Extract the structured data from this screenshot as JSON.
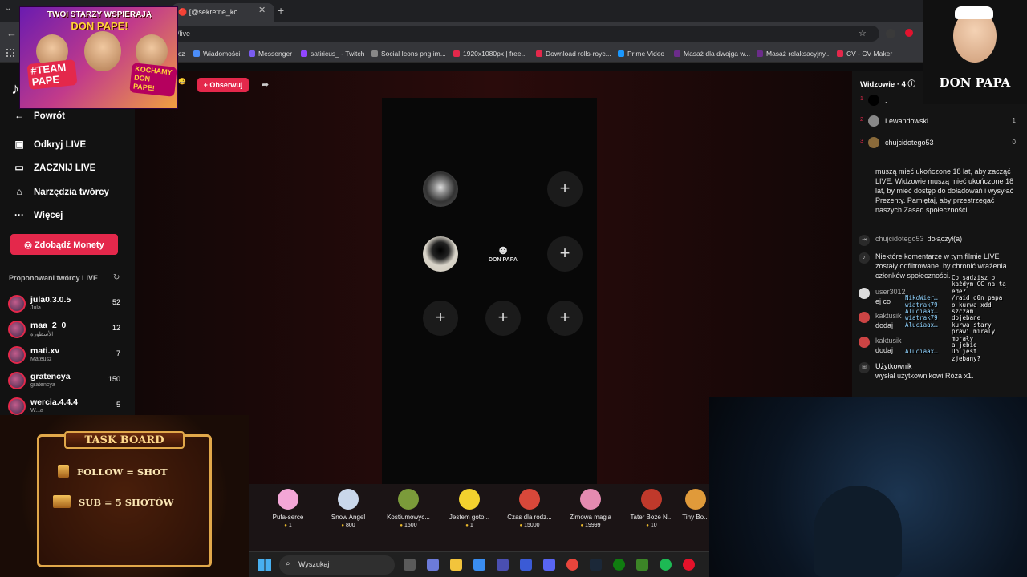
{
  "browser": {
    "tab_title": "🔴 [@sekretne_ko",
    "url": "7/live",
    "bookmarks": [
      {
        "label": "cz",
        "color": "#555"
      },
      {
        "label": "Wiadomości",
        "color": "#4b8df8"
      },
      {
        "label": "Messenger",
        "color": "#7a5cf0"
      },
      {
        "label": "satiricus_ - Twitch",
        "color": "#9146ff"
      },
      {
        "label": "Social Icons png im...",
        "color": "#888"
      },
      {
        "label": "1920x1080px | free...",
        "color": "#e4284b"
      },
      {
        "label": "Download rolls-royc...",
        "color": "#e4284b"
      },
      {
        "label": "Prime Video",
        "color": "#1a98ff"
      },
      {
        "label": "Masaż dla dwojga w...",
        "color": "#6b2c8a"
      },
      {
        "label": "Masaż relaksacyjny...",
        "color": "#6b2c8a"
      },
      {
        "label": "CV - CV Maker",
        "color": "#e4284b"
      }
    ]
  },
  "overlay": {
    "promo_line1": "TWOI STARZY WSPIERAJĄ",
    "promo_line2": "DON PAPE!",
    "promo_team": "#TEAM PAPE",
    "promo_love": "KOCHAMY DON PAPE!",
    "brand": "DON PAPA",
    "taskboard_title": "TASK BOARD",
    "task1": "FOLLOW = SHOT",
    "task2": "SUB = 5 SHOTÓW"
  },
  "stream": {
    "follow_label": "+ Obserwuj",
    "host_badge": "😀"
  },
  "sidebar": {
    "back": "Powrót",
    "nav": [
      "Odkryj LIVE",
      "ZACZNIJ LIVE",
      "Narzędzia twórcy",
      "Więcej"
    ],
    "coins": "Zdobądź Monety",
    "suggested_title": "Proponowani twórcy LIVE",
    "creators": [
      {
        "name": "jula0.3.0.5",
        "sub": "Jula",
        "count": "52"
      },
      {
        "name": "maa_2_0",
        "sub": "الأسطورة",
        "count": "12"
      },
      {
        "name": "mati.xv",
        "sub": "Mateusz",
        "count": "7"
      },
      {
        "name": "gratencya",
        "sub": "gratencya",
        "count": "150"
      },
      {
        "name": "wercia.4.4.4",
        "sub": "W...a",
        "count": "5"
      }
    ]
  },
  "stage": {
    "dp_label": "DON PAPA",
    "slot_plus": "+"
  },
  "gifts": [
    {
      "name": "Pufa-serce",
      "price": "1",
      "color": "#f3a6d6"
    },
    {
      "name": "Snow Angel",
      "price": "800",
      "color": "#c9d7ea"
    },
    {
      "name": "Kostiumowyc...",
      "price": "1500",
      "color": "#7b9b3a"
    },
    {
      "name": "Jestem goto...",
      "price": "1",
      "color": "#f2d12e"
    },
    {
      "name": "Czas dla rodz...",
      "price": "15000",
      "color": "#d8483a"
    },
    {
      "name": "Zimowa magia",
      "price": "19999",
      "color": "#e48ab0"
    },
    {
      "name": "Tater Boże N...",
      "price": "10",
      "color": "#c0392b"
    },
    {
      "name": "Tiny Bo...",
      "price": "",
      "color": "#e09a3a"
    }
  ],
  "panel": {
    "title": "Widzowie · 4 ⓘ",
    "viewers": [
      {
        "rank": "1",
        "name": ".",
        "score": ""
      },
      {
        "rank": "2",
        "name": "Lewandowski",
        "score": "1"
      },
      {
        "rank": "3",
        "name": "chujcidotego53",
        "score": "0"
      }
    ],
    "rules": "muszą mieć ukończone 18 lat, aby zacząć LIVE. Widzowie muszą mieć ukończone 18 lat, by mieć dostęp do doładowań i wysyłać Prezenty. Pamiętaj, aby przestrzegać naszych Zasad społeczności.",
    "joined_user": "chujcidotego53",
    "joined_text": "dołączył(a)",
    "filter_note": "Niektóre komentarze w tym filmie LIVE zostały odfiltrowane, by chronić wrażenia członków społeczności.",
    "msg1_user": "user3012",
    "msg1_text": "ej co",
    "msg2_user": "kaktusik",
    "msg2_text": "dodaj",
    "msg3_user": "kaktusik",
    "msg3_text": "dodaj",
    "msg4_user": "Użytkownik",
    "msg4_text": "wysłał użytkownikowi Róża x1."
  },
  "overlay_chat": [
    {
      "user": "",
      "msg": "Co sadzisz o"
    },
    {
      "user": "",
      "msg": "każdym CC na tą"
    },
    {
      "user": "",
      "msg": "ede?"
    },
    {
      "user": "NikoWier…",
      "msg": "/raid d0n_papa"
    },
    {
      "user": "wiatrak79",
      "msg": "o kurwa xdd"
    },
    {
      "user": "Aluciaax…",
      "msg": "szczam"
    },
    {
      "user": "wiatrak79",
      "msg": "dojebane"
    },
    {
      "user": "Aluciaax…",
      "msg": "kurwa stary"
    },
    {
      "user": "",
      "msg": "prawi miraly"
    },
    {
      "user": "",
      "msg": "morały"
    },
    {
      "user": "",
      "msg": "a jebie"
    },
    {
      "user": "Aluciaax…",
      "msg": "Do jest"
    },
    {
      "user": "",
      "msg": "zjebany?"
    }
  ],
  "taskbar": {
    "search": "Wyszukaj"
  },
  "colors": {
    "accent": "#e4284b",
    "stage_bg": "#080808",
    "gold": "#e1a84a"
  }
}
